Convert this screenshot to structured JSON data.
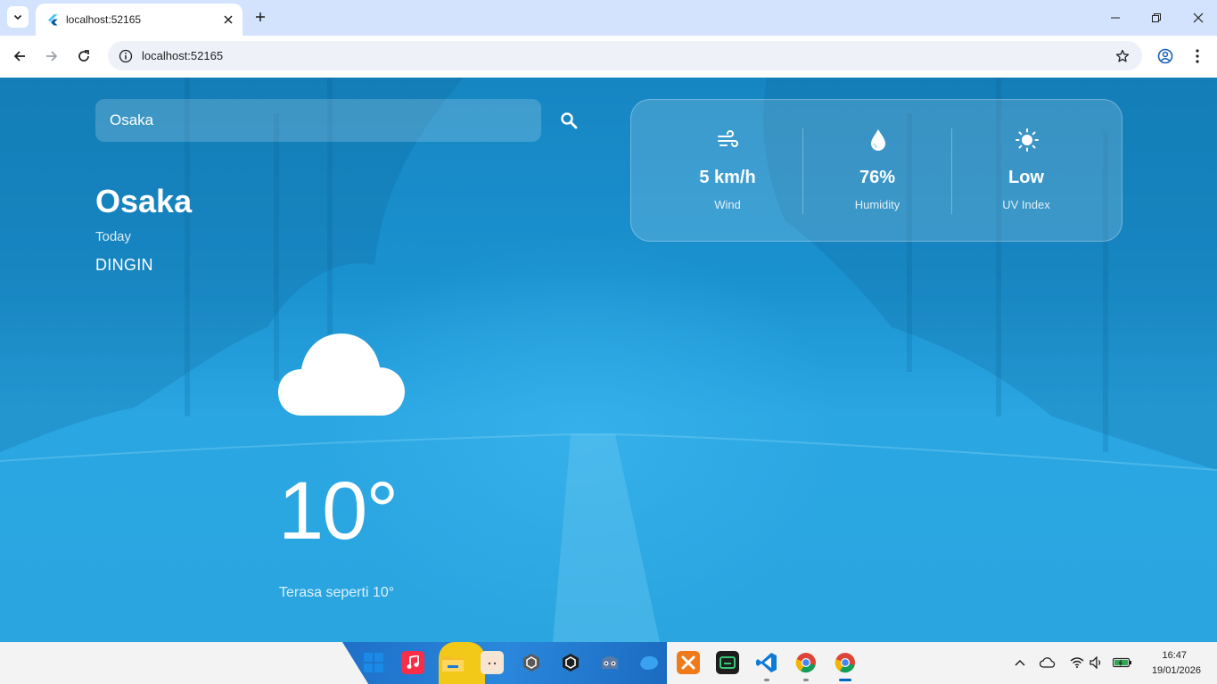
{
  "browser": {
    "tab_title": "localhost:52165",
    "url": "localhost:52165"
  },
  "search": {
    "value": "Osaka"
  },
  "weather": {
    "city": "Osaka",
    "day": "Today",
    "description": "DINGIN",
    "temperature": "10°",
    "feels_like": "Terasa seperti 10°",
    "condition_icon": "cloud-icon"
  },
  "stats": [
    {
      "icon": "wind-icon",
      "value": "5 km/h",
      "label": "Wind"
    },
    {
      "icon": "humidity-drop-icon",
      "value": "76%",
      "label": "Humidity"
    },
    {
      "icon": "sun-icon",
      "value": "Low",
      "label": "UV Index"
    }
  ],
  "colors": {
    "tabbar": "#d3e3fd",
    "page_bg": "#1a91cf",
    "text": "#ffffff"
  },
  "taskbar": {
    "apps": [
      "windows-start-icon",
      "music-app-icon",
      "file-explorer-icon",
      "anime-avatar-app-icon",
      "unity-hub-icon",
      "unity-editor-icon",
      "godot-icon",
      "bluebird-app-icon",
      "xampp-icon",
      "android-studio-icon",
      "vscode-icon",
      "chrome-icon",
      "chrome-active-icon"
    ],
    "time": "16:47",
    "date": "19/01/2026"
  }
}
